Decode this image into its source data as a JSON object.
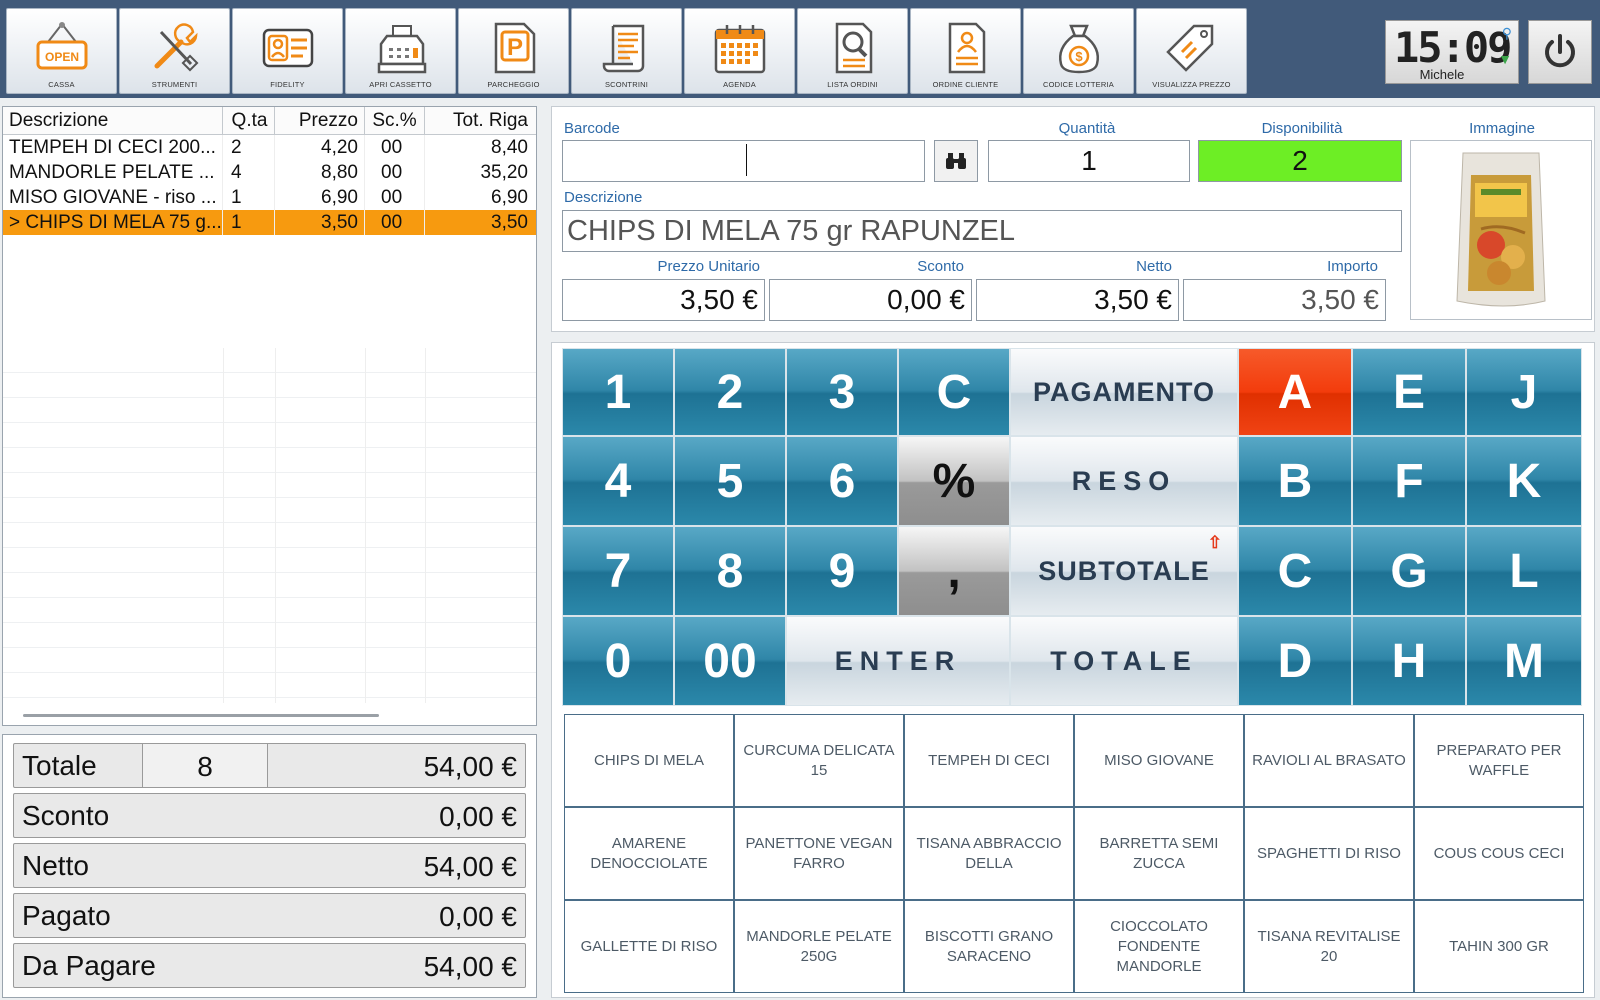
{
  "toolbar": {
    "buttons": [
      {
        "label": "CASSA",
        "icon": "open-sign-icon"
      },
      {
        "label": "STRUMENTI",
        "icon": "tools-icon"
      },
      {
        "label": "FIDELITY",
        "icon": "fidelity-card-icon"
      },
      {
        "label": "APRI CASSETTO",
        "icon": "cash-register-icon"
      },
      {
        "label": "PARCHEGGIO",
        "icon": "parking-icon"
      },
      {
        "label": "SCONTRINI",
        "icon": "receipt-scroll-icon"
      },
      {
        "label": "AGENDA",
        "icon": "calendar-icon"
      },
      {
        "label": "LISTA ORDINI",
        "icon": "order-search-icon"
      },
      {
        "label": "ORDINE CLIENTE",
        "icon": "customer-order-icon"
      },
      {
        "label": "CODICE LOTTERIA",
        "icon": "money-bag-icon"
      },
      {
        "label": "VISUALIZZA PREZZO",
        "icon": "price-tag-icon"
      }
    ],
    "open_sign_text": "OPEN",
    "parking_letter": "P",
    "clock": {
      "time": "15:09",
      "user": "Michele"
    }
  },
  "receipt": {
    "headers": [
      "Descrizione",
      "Q.ta",
      "Prezzo",
      "Sc.%",
      "Tot. Riga"
    ],
    "rows": [
      {
        "desc": "TEMPEH DI CECI 200...",
        "qty": "2",
        "price": "4,20",
        "disc": "00",
        "total": "8,40",
        "selected": false
      },
      {
        "desc": "MANDORLE PELATE ...",
        "qty": "4",
        "price": "8,80",
        "disc": "00",
        "total": "35,20",
        "selected": false
      },
      {
        "desc": "MISO GIOVANE -  riso ...",
        "qty": "1",
        "price": "6,90",
        "disc": "00",
        "total": "6,90",
        "selected": false
      },
      {
        "desc": "> CHIPS DI MELA 75 g...",
        "qty": "1",
        "price": "3,50",
        "disc": "00",
        "total": "3,50",
        "selected": true
      }
    ]
  },
  "totals": {
    "totale_label": "Totale",
    "totale_count": "8",
    "totale_value": "54,00 €",
    "sconto_label": "Sconto",
    "sconto_value": "0,00 €",
    "netto_label": "Netto",
    "netto_value": "54,00 €",
    "pagato_label": "Pagato",
    "pagato_value": "0,00 €",
    "dapagare_label": "Da Pagare",
    "dapagare_value": "54,00 €"
  },
  "entry": {
    "barcode_label": "Barcode",
    "barcode_value": "",
    "quantity_label": "Quantità",
    "quantity_value": "1",
    "availability_label": "Disponibilità",
    "availability_value": "2",
    "image_label": "Immagine",
    "description_label": "Descrizione",
    "description_value": "CHIPS DI MELA 75 gr RAPUNZEL",
    "unit_price_label": "Prezzo Unitario",
    "unit_price_value": "3,50 €",
    "discount_label": "Sconto",
    "discount_value": "0,00 €",
    "net_label": "Netto",
    "net_value": "3,50 €",
    "amount_label": "Importo",
    "amount_value": "3,50 €",
    "availability_color": "#6dee25"
  },
  "keypad": {
    "digits": [
      "1",
      "2",
      "3",
      "4",
      "5",
      "6",
      "7",
      "8",
      "9",
      "0",
      "00"
    ],
    "clear": "C",
    "percent": "%",
    "comma": ",",
    "enter": "ENTER",
    "pagamento": "PAGAMENTO",
    "reso": "RESO",
    "subtotale": "SUBTOTALE",
    "totale": "TOTALE",
    "letters": [
      "A",
      "E",
      "J",
      "B",
      "F",
      "K",
      "C",
      "G",
      "L",
      "D",
      "H",
      "M"
    ],
    "active_letter_color": "#f33c0c"
  },
  "products": [
    "CHIPS DI MELA",
    "CURCUMA DELICATA 15",
    "TEMPEH DI CECI",
    "MISO GIOVANE",
    "RAVIOLI AL BRASATO",
    "PREPARATO PER WAFFLE",
    "AMARENE DENOCCIOLATE",
    "PANETTONE VEGAN FARRO",
    "TISANA ABBRACCIO DELLA",
    "BARRETTA SEMI ZUCCA",
    "SPAGHETTI DI RISO",
    "COUS COUS CECI",
    "GALLETTE DI RISO",
    "MANDORLE PELATE 250G",
    "BISCOTTI GRANO SARACENO",
    "CIOCCOLATO FONDENTE MANDORLE",
    "TISANA REVITALISE 20",
    "TAHIN 300 GR"
  ]
}
